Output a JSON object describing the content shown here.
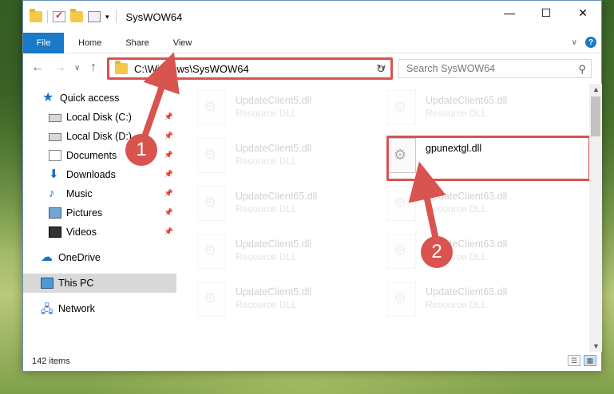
{
  "window": {
    "title": "SysWOW64"
  },
  "window_controls": {
    "minimize": "—",
    "maximize": "☐",
    "close": "✕"
  },
  "ribbon": {
    "file": "File",
    "tabs": [
      "Home",
      "Share",
      "View"
    ],
    "expand": "∨",
    "help": "?"
  },
  "nav": {
    "back": "←",
    "forward": "→",
    "recent": "∨",
    "up": "↑"
  },
  "address": {
    "path": "C:\\Windows\\SysWOW64",
    "dropdown": "∨",
    "refresh": "↻"
  },
  "search": {
    "placeholder": "Search SysWOW64",
    "icon": "search-icon"
  },
  "sidebar": {
    "items": [
      {
        "label": "Quick access",
        "icon": "star-icon"
      },
      {
        "label": "Local Disk (C:)",
        "icon": "disk-icon",
        "pinned": true
      },
      {
        "label": "Local Disk (D:)",
        "icon": "disk-icon",
        "pinned": true
      },
      {
        "label": "Documents",
        "icon": "document-icon",
        "pinned": true
      },
      {
        "label": "Downloads",
        "icon": "download-icon",
        "pinned": true
      },
      {
        "label": "Music",
        "icon": "music-icon",
        "pinned": true
      },
      {
        "label": "Pictures",
        "icon": "pictures-icon",
        "pinned": true
      },
      {
        "label": "Videos",
        "icon": "videos-icon",
        "pinned": true
      },
      {
        "label": "OneDrive",
        "icon": "cloud-icon"
      },
      {
        "label": "This PC",
        "icon": "computer-icon",
        "selected": true
      },
      {
        "label": "Network",
        "icon": "network-icon"
      }
    ]
  },
  "files": [
    {
      "name": "UpdateClient5.dll",
      "type": "Resource DLL",
      "faded": true
    },
    {
      "name": "UpdateClient65.dll",
      "type": "Resource DLL",
      "faded": true
    },
    {
      "name": "UpdateClient5.dll",
      "type": "Resource DLL",
      "faded": true
    },
    {
      "name": "gpunextgl.dll",
      "type": "",
      "faded": false
    },
    {
      "name": "UpdateClient65.dll",
      "type": "Resource DLL",
      "faded": true
    },
    {
      "name": "UpdateClient63.dll",
      "type": "Resource DLL",
      "faded": true
    },
    {
      "name": "UpdateClient5.dll",
      "type": "Resource DLL",
      "faded": true
    },
    {
      "name": "UpdateClient63.dll",
      "type": "Resource DLL",
      "faded": true
    },
    {
      "name": "UpdateClient5.dll",
      "type": "Resource DLL",
      "faded": true
    },
    {
      "name": "UpdateClient65.dll",
      "type": "Resource DLL",
      "faded": true
    }
  ],
  "status": {
    "count": "142 items"
  },
  "annotations": {
    "marker1": "1",
    "marker2": "2",
    "color": "#d9534f"
  }
}
